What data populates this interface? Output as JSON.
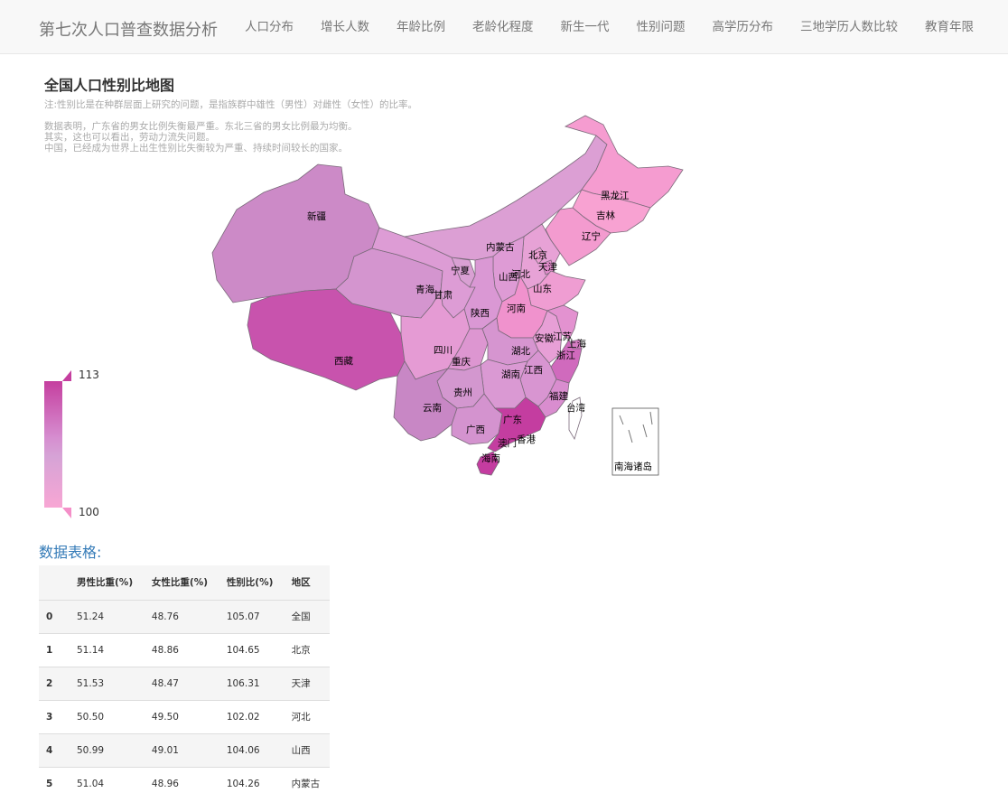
{
  "navbar": {
    "brand": "第七次人口普查数据分析",
    "items": [
      "人口分布",
      "增长人数",
      "年龄比例",
      "老龄化程度",
      "新生一代",
      "性别问题",
      "高学历分布",
      "三地学历人数比较",
      "教育年限"
    ]
  },
  "chart": {
    "title": "全国人口性别比地图",
    "subtitle_lines": [
      "注:性别比是在种群层面上研究的问题，是指族群中雄性（男性）对雌性（女性）的比率。",
      "",
      "数据表明，广东省的男女比例失衡最严重。东北三省的男女比例最为均衡。",
      "其实，这也可以看出，劳动力流失问题。",
      "中国，已经成为世界上出生性别比失衡较为严重、持续时间较长的国家。"
    ]
  },
  "chart_data": {
    "type": "map",
    "title": "全国人口性别比地图",
    "visual_map": {
      "min": 100,
      "max": 113,
      "max_label": "113",
      "min_label": "100",
      "color_high": "#c53f9f",
      "color_low": "#f8a6d4"
    },
    "regions": [
      "新疆",
      "西藏",
      "青海",
      "甘肃",
      "宁夏",
      "内蒙古",
      "黑龙江",
      "吉林",
      "辽宁",
      "北京",
      "天津",
      "河北",
      "山西",
      "山东",
      "陕西",
      "河南",
      "四川",
      "重庆",
      "湖北",
      "安徽",
      "江苏",
      "上海",
      "浙江",
      "湖南",
      "江西",
      "贵州",
      "云南",
      "广西",
      "广东",
      "福建",
      "台湾",
      "澳门",
      "香港",
      "海南"
    ],
    "inset_label": "南海诸岛"
  },
  "table": {
    "title": "数据表格:",
    "columns": [
      "",
      "男性比重(%)",
      "女性比重(%)",
      "性别比(%)",
      "地区"
    ],
    "rows": [
      [
        "0",
        "51.24",
        "48.76",
        "105.07",
        "全国"
      ],
      [
        "1",
        "51.14",
        "48.86",
        "104.65",
        "北京"
      ],
      [
        "2",
        "51.53",
        "48.47",
        "106.31",
        "天津"
      ],
      [
        "3",
        "50.50",
        "49.50",
        "102.02",
        "河北"
      ],
      [
        "4",
        "50.99",
        "49.01",
        "104.06",
        "山西"
      ],
      [
        "5",
        "51.04",
        "48.96",
        "104.26",
        "内蒙古"
      ]
    ]
  }
}
